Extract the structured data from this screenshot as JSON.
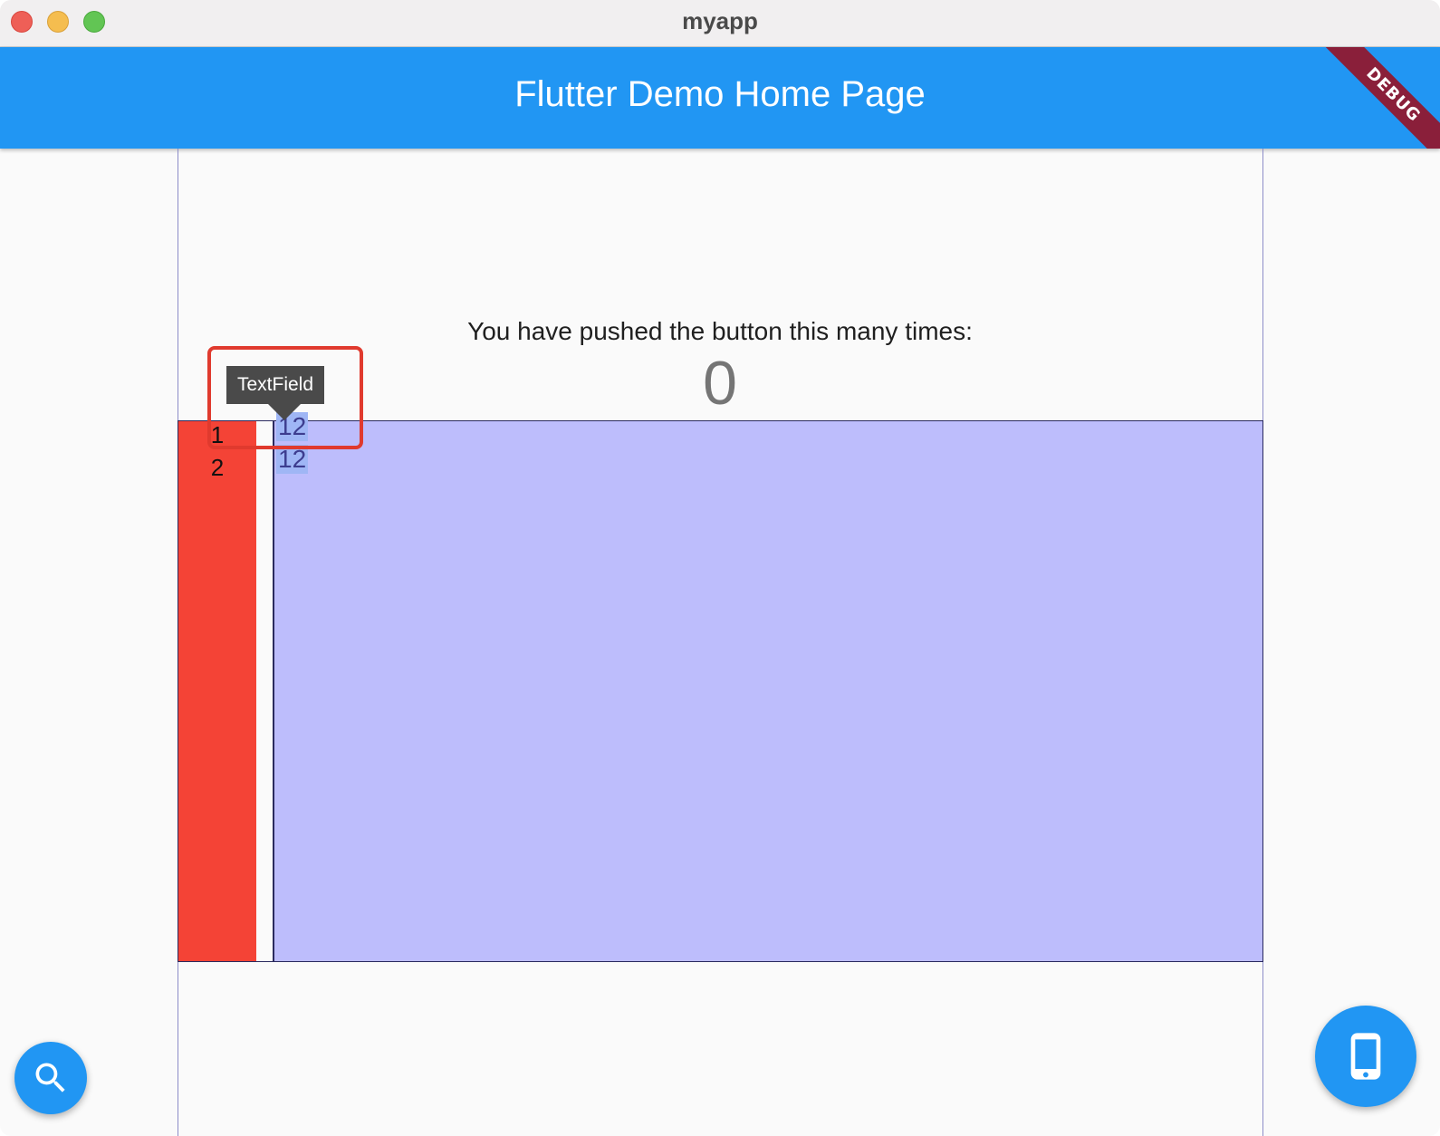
{
  "window": {
    "title": "myapp"
  },
  "appbar": {
    "title": "Flutter Demo Home Page",
    "debug_banner": "DEBUG"
  },
  "counter": {
    "label": "You have pushed the button this many times:",
    "value": "0"
  },
  "editor": {
    "lines": [
      {
        "number": "1",
        "text": "12"
      },
      {
        "number": "2",
        "text": "12"
      }
    ]
  },
  "tooltip": {
    "text": "TextField"
  },
  "fabs": {
    "search_icon": "search-icon",
    "device_icon": "smartphone-icon"
  },
  "colors": {
    "appbar": "#2196f3",
    "gutter": "#f44336",
    "editor_bg": "#bdbdfc",
    "highlight": "#e03a2e"
  }
}
